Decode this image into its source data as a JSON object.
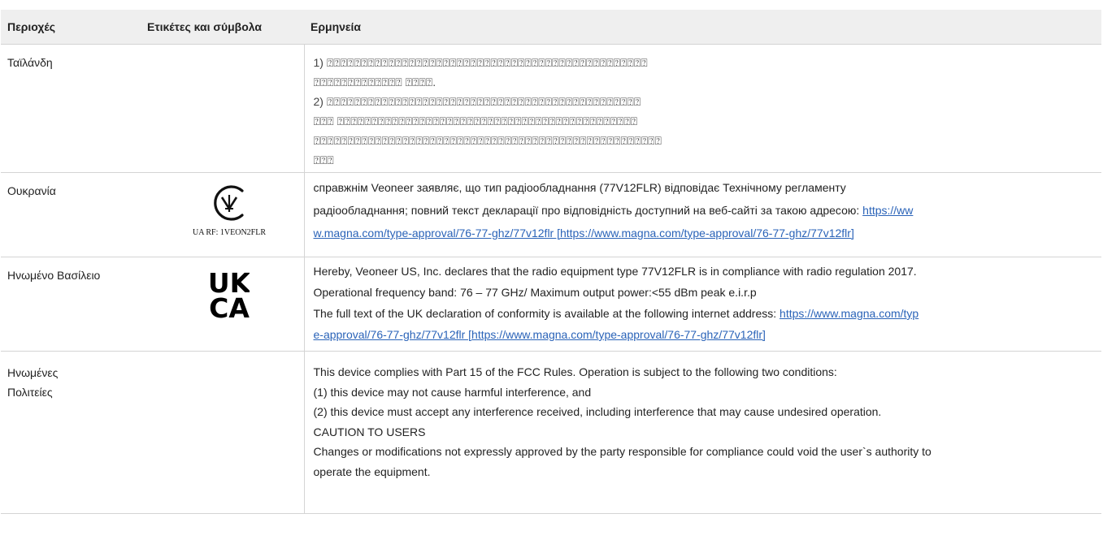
{
  "header": {
    "col_regions": "Περιοχές",
    "col_labels": "Ετικέτες και σύμβολα",
    "col_interpretation": "Ερμηνεία"
  },
  "rows": {
    "thailand": {
      "region": "Ταϊλάνδη",
      "lines": [
        "1) ⍰⍰⍰⍰⍰⍰⍰⍰⍰⍰⍰⍰⍰⍰⍰⍰⍰⍰⍰⍰⍰⍰⍰⍰⍰⍰⍰⍰⍰⍰⍰⍰⍰⍰⍰⍰⍰⍰⍰⍰⍰⍰⍰⍰⍰⍰⍰",
        "⍰⍰⍰⍰⍰⍰⍰⍰⍰⍰⍰⍰⍰ ⍰⍰⍰⍰.",
        "2) ⍰⍰⍰⍰⍰⍰⍰⍰⍰⍰⍰⍰⍰⍰⍰⍰⍰⍰⍰⍰⍰⍰⍰⍰⍰⍰⍰⍰⍰⍰⍰⍰⍰⍰⍰⍰⍰⍰⍰⍰⍰⍰⍰⍰⍰⍰",
        "⍰⍰⍰ ⍰⍰⍰⍰⍰⍰⍰⍰⍰⍰⍰⍰⍰⍰⍰⍰⍰⍰⍰⍰⍰⍰⍰⍰⍰⍰⍰⍰⍰⍰⍰⍰⍰⍰⍰⍰⍰⍰⍰⍰⍰⍰⍰⍰",
        "⍰⍰⍰⍰⍰⍰⍰⍰⍰⍰⍰⍰⍰⍰⍰⍰⍰⍰⍰⍰⍰⍰⍰⍰⍰⍰⍰⍰⍰⍰⍰⍰⍰⍰⍰⍰⍰⍰⍰⍰⍰⍰⍰⍰⍰⍰⍰⍰⍰⍰⍰",
        "⍰⍰⍰"
      ]
    },
    "ukraine": {
      "region": "Ουκρανία",
      "mark_caption": "UA RF: 1VEON2FLR",
      "text_1": "справжнім Veoneer заявляє, що тип радіообладнання (77V12FLR) відповідає Технічному регламенту",
      "text_2": "радіообладнання; повний текст декларації про відповідність доступний на веб-сайті за такою адресою: ",
      "link_part1": "https://ww",
      "link_part2": "w.magna.com/type-approval/76-77-ghz/77v12flr [https://www.magna.com/type-approval/76-77-ghz/77v12flr]"
    },
    "uk": {
      "region": "Ηνωμένο Βασίλειο",
      "mark_top": "UK",
      "mark_bottom": "CA",
      "text_1": "Hereby, Veoneer US, Inc. declares that the radio equipment type 77V12FLR is in compliance with radio regulation 2017.",
      "text_2": "Operational frequency band: 76 – 77 GHz/ Maximum output power:<55 dBm peak e.i.r.p",
      "text_3": "The full text of the UK declaration of conformity is available at the following internet address: ",
      "link_part1": "https://www.magna.com/typ",
      "link_part2": "e-approval/76-77-ghz/77v12flr [https://www.magna.com/type-approval/76-77-ghz/77v12flr]"
    },
    "us": {
      "region_line1": "Ηνωμένες",
      "region_line2": "Πολιτείες",
      "lines": [
        "This device complies with Part 15 of the FCC Rules. Operation is subject to the following two conditions:",
        "(1) this device may not cause harmful interference, and",
        "(2) this device must accept any interference received, including interference that may cause undesired operation.",
        "CAUTION TO USERS",
        "Changes or modifications not expressly approved by the party responsible for compliance could void the user`s authority to",
        "operate the equipment."
      ]
    }
  }
}
